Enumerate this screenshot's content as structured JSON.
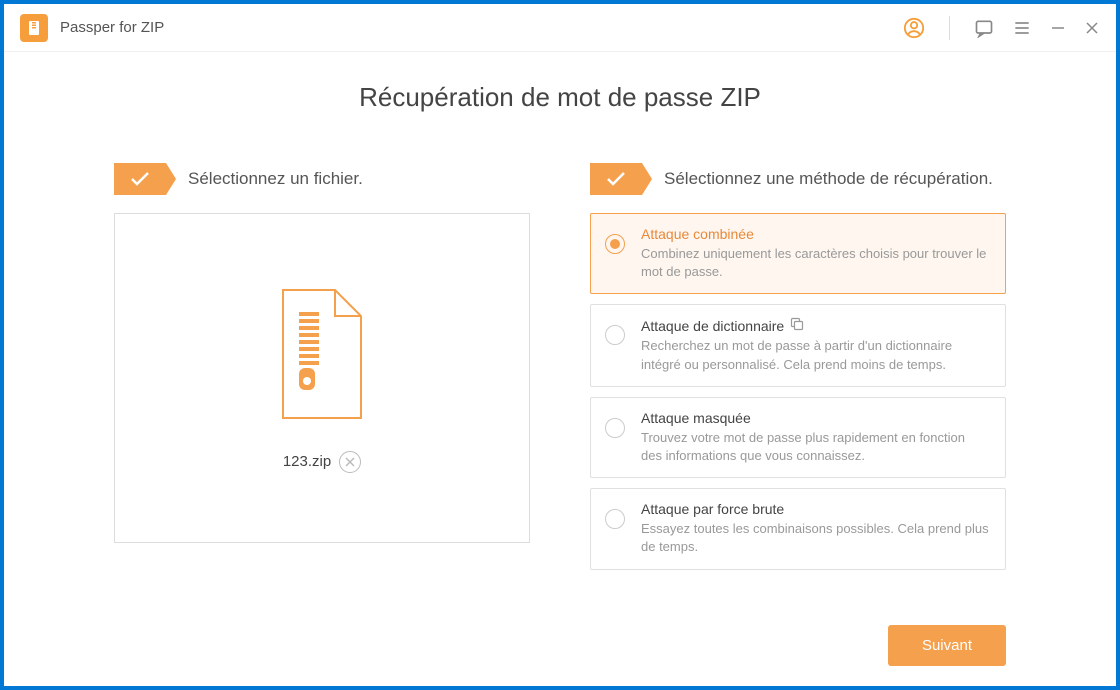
{
  "app": {
    "title": "Passper for ZIP"
  },
  "page": {
    "title": "Récupération de mot de passe ZIP"
  },
  "step1": {
    "label": "Sélectionnez un fichier.",
    "filename": "123.zip"
  },
  "step2": {
    "label": "Sélectionnez une méthode de récupération.",
    "methods": [
      {
        "title": "Attaque combinée",
        "desc": "Combinez uniquement les caractères choisis pour trouver le mot de passe."
      },
      {
        "title": "Attaque de dictionnaire",
        "desc": "Recherchez un mot de passe à partir d'un dictionnaire intégré ou personnalisé. Cela prend moins de temps."
      },
      {
        "title": "Attaque masquée",
        "desc": "Trouvez votre mot de passe plus rapidement en fonction des informations que vous connaissez."
      },
      {
        "title": "Attaque par force brute",
        "desc": "Essayez toutes les combinaisons possibles. Cela prend plus de temps."
      }
    ]
  },
  "footer": {
    "next": "Suivant"
  }
}
